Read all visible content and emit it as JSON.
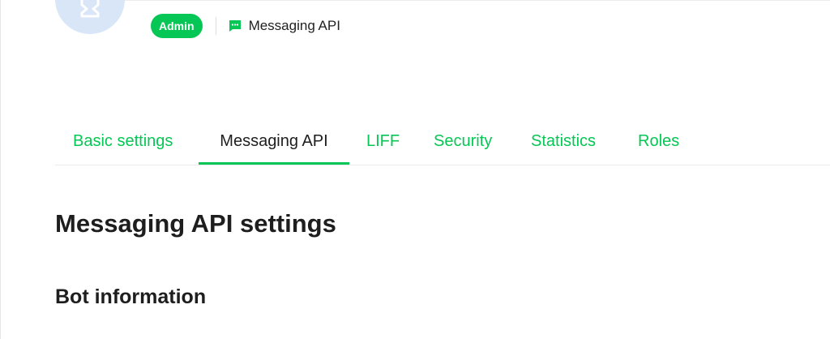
{
  "header": {
    "role_badge": "Admin",
    "channel_type": "Messaging API",
    "icons": {
      "avatar": "user-placeholder-icon",
      "channel_type": "chat-bubble-icon"
    }
  },
  "tabs": [
    {
      "label": "Basic settings",
      "active": false
    },
    {
      "label": "Messaging API",
      "active": true
    },
    {
      "label": "LIFF",
      "active": false
    },
    {
      "label": "Security",
      "active": false
    },
    {
      "label": "Statistics",
      "active": false
    },
    {
      "label": "Roles",
      "active": false
    }
  ],
  "main": {
    "title": "Messaging API settings",
    "section_title": "Bot information"
  },
  "colors": {
    "accent": "#06c755",
    "text": "#1e1e1e",
    "avatar_bg": "#d8e6f7"
  }
}
